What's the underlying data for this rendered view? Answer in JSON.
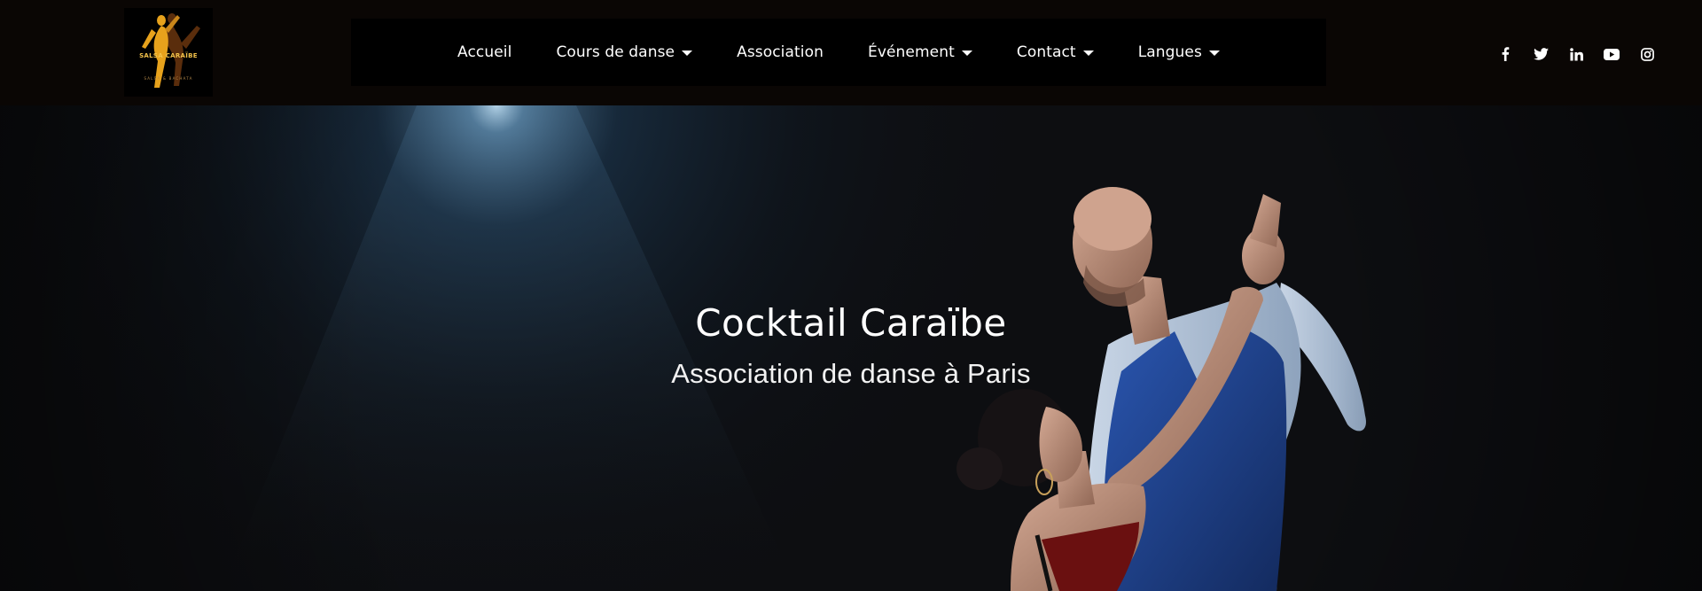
{
  "logo": {
    "text": "SALSA CARAÏBE",
    "tagline": "SALSA & BACHATA",
    "icon": "dancing-couple-logo"
  },
  "nav": {
    "items": [
      {
        "label": "Accueil",
        "dropdown": false
      },
      {
        "label": "Cours de danse",
        "dropdown": true
      },
      {
        "label": "Association",
        "dropdown": false
      },
      {
        "label": "Événement",
        "dropdown": true
      },
      {
        "label": "Contact",
        "dropdown": true
      },
      {
        "label": "Langues",
        "dropdown": true
      }
    ]
  },
  "social": {
    "icons": [
      "facebook-icon",
      "twitter-icon",
      "linkedin-icon",
      "youtube-icon",
      "instagram-icon"
    ]
  },
  "hero": {
    "title": "Cocktail Caraïbe",
    "subtitle": "Association de danse à Paris",
    "image": "dancing-couple-photo"
  },
  "colors": {
    "header_bg": "#0a0604",
    "nav_bg": "#000000",
    "hero_bg": "#0d0e11",
    "text": "#ffffff",
    "logo_accent": "#e7a21c",
    "vest_blue": "#1f3f86"
  }
}
